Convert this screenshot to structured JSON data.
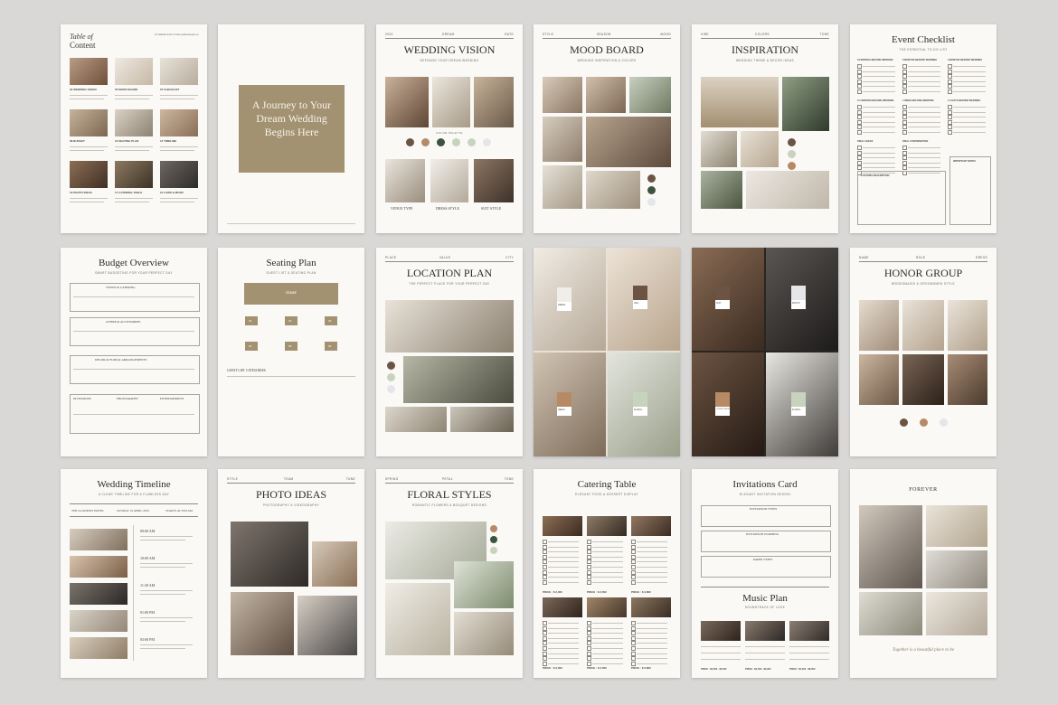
{
  "pages": {
    "toc": {
      "title_line1": "Table of",
      "title_line2": "Content",
      "intro": "Lil Sabelle dolor ornare pellentesque et",
      "items": [
        "04 WEDDING VISION",
        "05 MOOD BOARD",
        "07 CHECKLIST",
        "08 BUDGET",
        "10 SEATING PLAN",
        "14 TIMELINE",
        "19 PHOTO IDEAS",
        "17 CATERING TABLE",
        "21 CARD & MUSIC"
      ]
    },
    "journey": {
      "text": "A Journey to Your Dream Wedding Begins Here"
    },
    "vision": {
      "title": "WEDDING VISION",
      "subtitle": "DEFINING YOUR DREAM WEDDING",
      "hdr": [
        "2024",
        "DREAM",
        "DATE"
      ],
      "palette_label": "COLOR PALETTE",
      "captions": [
        "VENUE TYPE",
        "DRESS STYLE",
        "SUIT STYLE"
      ]
    },
    "moodboard": {
      "title": "MOOD BOARD",
      "subtitle": "WEDDING INSPIRATION & COLORS",
      "hdr": [
        "STYLE",
        "SEASON",
        "MOOD"
      ]
    },
    "inspiration": {
      "title": "INSPIRATION",
      "subtitle": "WEDDING THEME & DECOR IDEAS",
      "hdr": [
        "VIBE",
        "COLORS",
        "TONE"
      ]
    },
    "checklist": {
      "title": "Event Checklist",
      "subtitle": "THE ESSENTIAL TO-DO LIST",
      "sections": [
        "12 MONTHS BEFORE WEDDING",
        "6 MONTHS BEFORE WEDDING",
        "3 MONTHS BEFORE WEDDING",
        "3-1 MONTHS BEFORE WEDDING",
        "1 WEEK BEFORE WEDDING",
        "1-3 DAYS BEFORE WEDDING",
        "FINAL CHECK",
        "FINAL CONFIRMATION",
        "CUSTOMS DESCRIPTION",
        "IMPORTANT NOTES"
      ]
    },
    "budget": {
      "title": "Budget Overview",
      "subtitle": "SMART BUDGETING FOR YOUR PERFECT DAY",
      "sections": [
        "VENUE & CATERING",
        "ATTIRE & ACCESSORIES",
        "DECOR & FLORAL ARRANGEMENTS"
      ],
      "bottom": [
        "INVITATIONS",
        "PHOTOGRAPHY",
        "ENTERTAINMENT"
      ]
    },
    "seating": {
      "title": "Seating Plan",
      "subtitle": "GUEST LIST & SEATING PLAN",
      "stage": "STAGE",
      "tables": [
        "01",
        "02",
        "03",
        "04",
        "05",
        "06"
      ],
      "categories": "GUEST LIST CATEGORIES"
    },
    "location": {
      "title": "LOCATION PLAN",
      "subtitle": "THE PERFECT PLACE FOR YOUR PERFECT DAY",
      "hdr": [
        "PLACE",
        "VALUE",
        "CITY"
      ]
    },
    "swatch1": {
      "cards": [
        "DRESS",
        "VEIL",
        "HEELS",
        "FLORAL"
      ]
    },
    "swatch2": {
      "cards": [
        "SUIT",
        "WATCH",
        "COURT SHOES",
        "FLORAL"
      ]
    },
    "honor": {
      "title": "HONOR GROUP",
      "subtitle": "BRIDESMAIDS & GROOMSMEN STYLE",
      "hdr": [
        "NAME",
        "ROLE",
        "DRESS"
      ]
    },
    "timeline": {
      "title": "Wedding Timeline",
      "subtitle": "A CLEAR TIMELINE FOR A FLAWLESS DAY",
      "info": [
        "THE ACADEMY HOTEL",
        "SUNDAY 19 APRIL 2032",
        "STARTS AT 9:00 AM"
      ],
      "times": [
        "09:00 AM",
        "10:00 AM",
        "11:30 AM",
        "01:00 PM",
        "03:00 PM"
      ]
    },
    "photo": {
      "title": "PHOTO IDEAS",
      "subtitle": "PHOTOGRAPHY & VIDEOGRAPHY",
      "hdr": [
        "STYLE",
        "TEAM",
        "TONE"
      ]
    },
    "floral": {
      "title": "FLORAL STYLES",
      "subtitle": "ROMANTIC FLOWERS & BOUQUET DESIGNS",
      "hdr": [
        "SPRING",
        "PETAL",
        "TONE"
      ]
    },
    "catering": {
      "title": "Catering Table",
      "subtitle": "ELEGANT FOOD & DESSERT DISPLAY",
      "prices": [
        "PRICE : $ 2,000",
        "PRICE : $ 2,500",
        "PRICE : $ 2,800",
        "PRICE : $ 2,000",
        "PRICE : $ 2,500",
        "PRICE : $ 2,800"
      ]
    },
    "invitations": {
      "title": "Invitations Card",
      "subtitle": "ELEGANT INVITATION DESIGN",
      "rows": [
        "INVITATION TYPES",
        "INVITATION WORDING",
        "PAPER TYPES"
      ],
      "music_title": "Music Plan",
      "music_subtitle": "SOUNDTRACK OF LOVE",
      "prices": [
        "PRICE : $3,500 - $5,000",
        "PRICE : $2,500 - $3,000",
        "PRICE : $5,000 - $8,000"
      ]
    },
    "forever": {
      "title": "FOREVER",
      "script": "Together is a beautiful place to be"
    }
  },
  "colors": {
    "page": "#faf9f6",
    "background": "#d9d8d6",
    "taupe": "#a39272",
    "dark_brown": "#6b5444",
    "camel": "#b78a66",
    "sage": "#c7d3bd",
    "forest": "#3d5240",
    "mist": "#e4e6ea"
  }
}
